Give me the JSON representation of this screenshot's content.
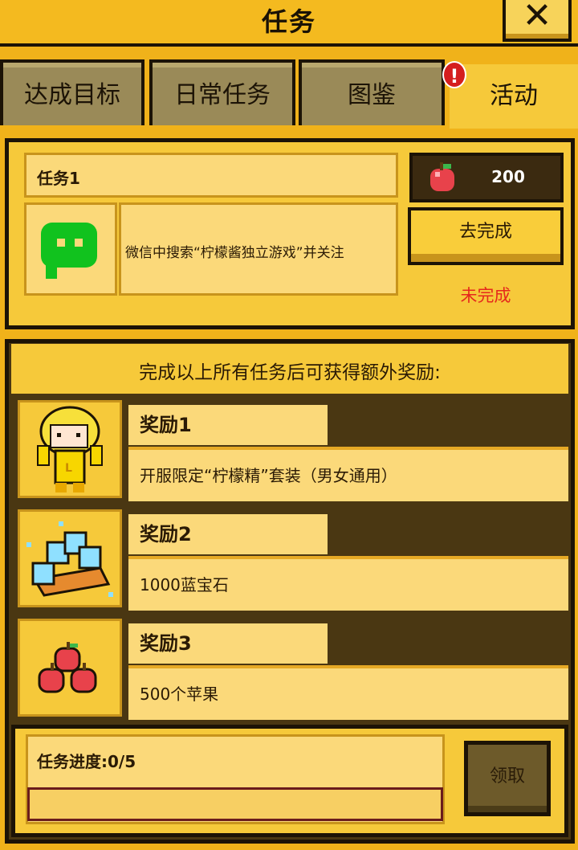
{
  "header": {
    "title": "任务",
    "close_icon": "close-icon"
  },
  "tabs": [
    {
      "label": "达成目标"
    },
    {
      "label": "日常任务"
    },
    {
      "label": "图鉴"
    },
    {
      "label": "活动",
      "active": true
    }
  ],
  "alert_badge": "!",
  "task": {
    "name": "任务1",
    "description": "微信中搜索“柠檬酱独立游戏”并关注",
    "reward_icon": "apple-icon",
    "reward_count": "200",
    "action_label": "去完成",
    "status": "未完成",
    "app_icon": "wechat-icon"
  },
  "bonus": {
    "title": "完成以上所有任务后可获得额外奖励:",
    "rewards": [
      {
        "label": "奖励1",
        "desc": "开服限定“柠檬精”套装（男女通用）",
        "icon": "lemon-character-icon"
      },
      {
        "label": "奖励2",
        "desc": "1000蓝宝石",
        "icon": "sapphire-icon"
      },
      {
        "label": "奖励3",
        "desc": "500个苹果",
        "icon": "apples-icon"
      }
    ]
  },
  "progress": {
    "label": "任务进度:0/5",
    "value": 0,
    "total": 5,
    "claim_label": "领取"
  },
  "colors": {
    "accent": "#f0b21a",
    "dark": "#1c1306",
    "status_red": "#e5281c"
  }
}
